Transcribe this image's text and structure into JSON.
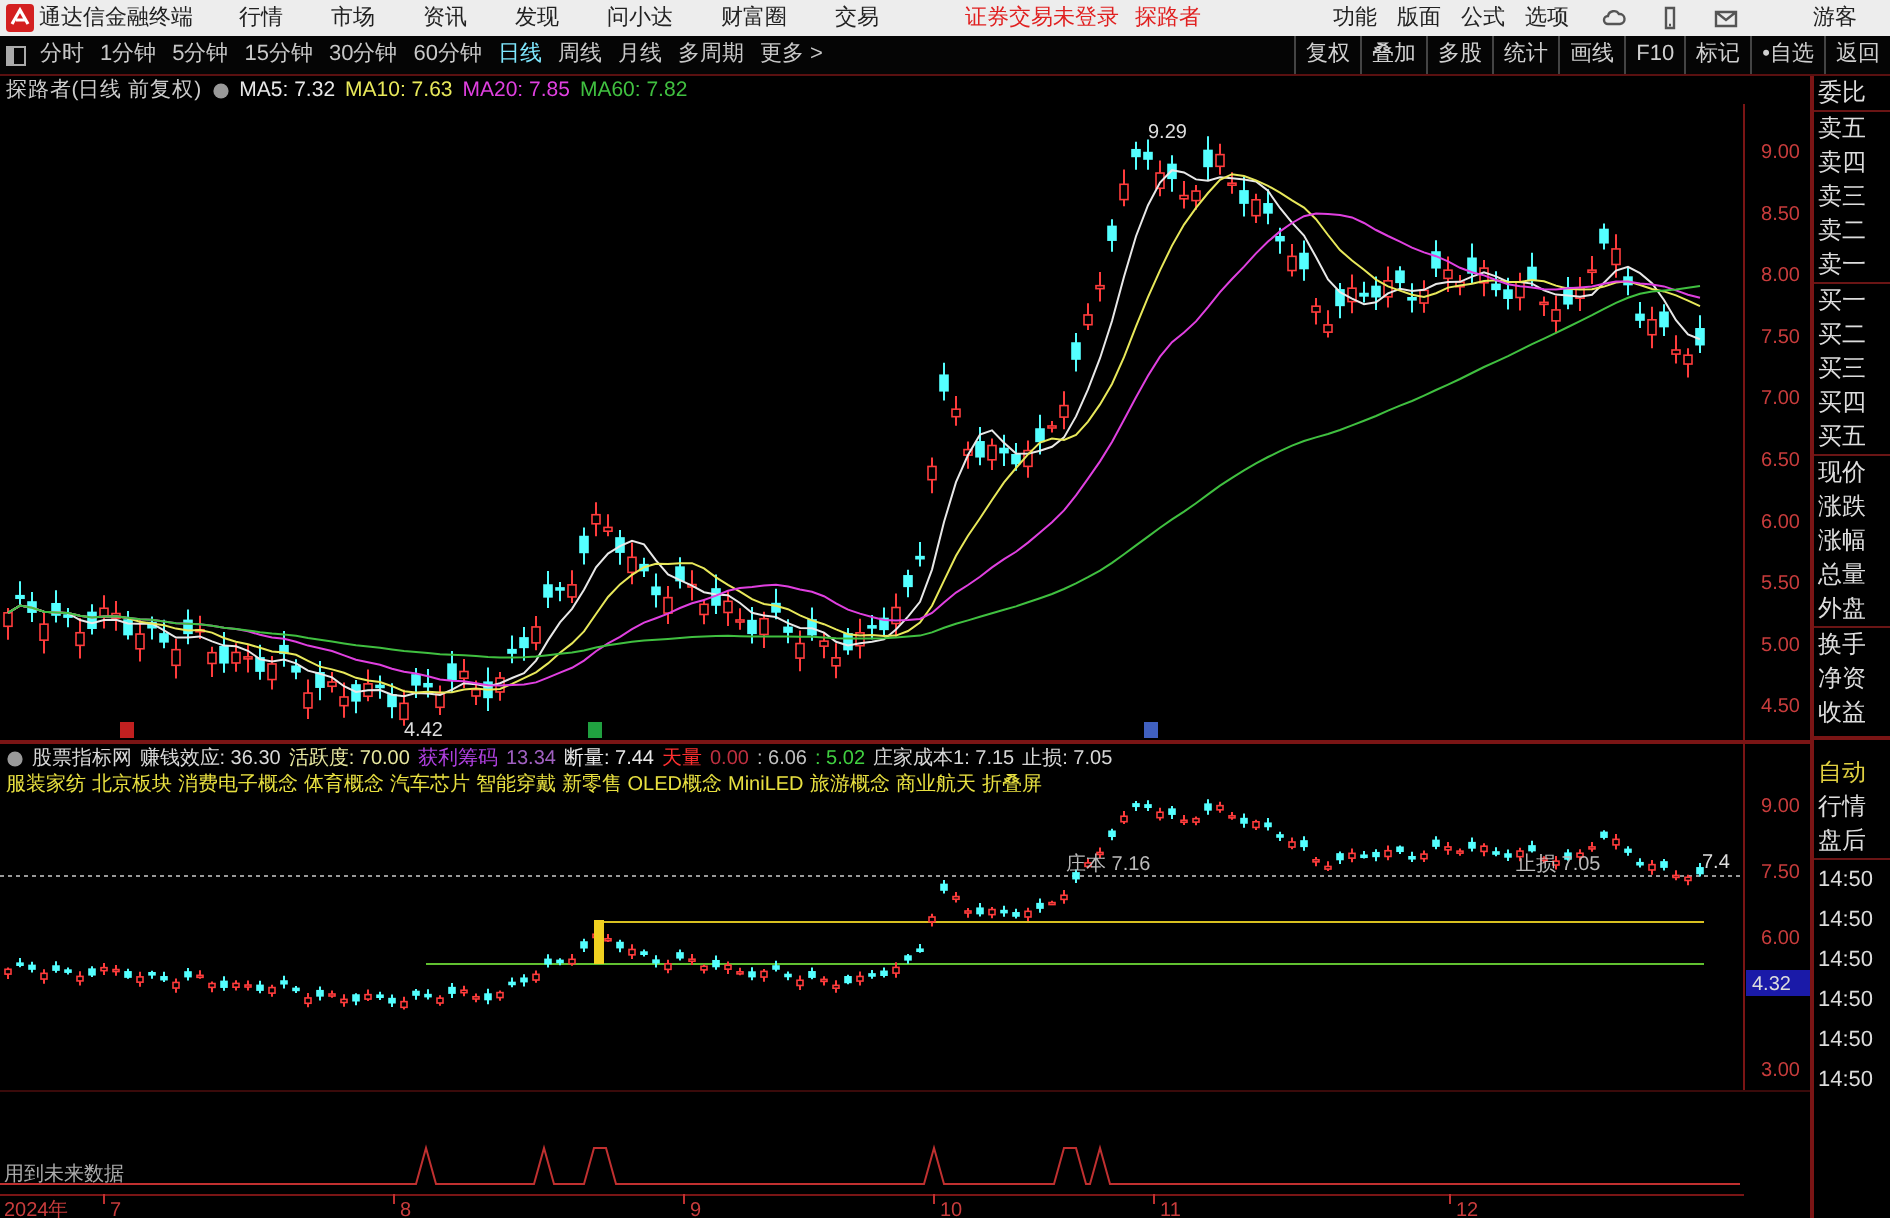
{
  "app_bar": {
    "title": "通达信金融终端",
    "menus": [
      "行情",
      "市场",
      "资讯",
      "发现",
      "问小达",
      "财富圈",
      "交易"
    ],
    "login_status": "证券交易未登录",
    "stock_name": "探路者",
    "tools": [
      "功能",
      "版面",
      "公式",
      "选项"
    ],
    "user": "游客"
  },
  "period_bar": {
    "periods": [
      {
        "label": "分时",
        "selected": false
      },
      {
        "label": "1分钟",
        "selected": false
      },
      {
        "label": "5分钟",
        "selected": false
      },
      {
        "label": "15分钟",
        "selected": false
      },
      {
        "label": "30分钟",
        "selected": false
      },
      {
        "label": "60分钟",
        "selected": false
      },
      {
        "label": "日线",
        "selected": true
      },
      {
        "label": "周线",
        "selected": false
      },
      {
        "label": "月线",
        "selected": false
      },
      {
        "label": "多周期",
        "selected": false
      }
    ],
    "more": "更多 >",
    "actions": [
      "复权",
      "叠加",
      "多股",
      "统计",
      "画线",
      "F10",
      "标记",
      "•自选",
      "返回"
    ]
  },
  "main_chart": {
    "title": "探路者(日线 前复权)",
    "ma": [
      {
        "label": "MA5: 7.32",
        "color": "#e8e8e8"
      },
      {
        "label": "MA10: 7.63",
        "color": "#e8e85a"
      },
      {
        "label": "MA20: 7.85",
        "color": "#e040e0"
      },
      {
        "label": "MA60: 7.82",
        "color": "#40c040"
      }
    ],
    "price_ticks": [
      "9.00",
      "8.50",
      "8.00",
      "7.50",
      "7.00",
      "6.50",
      "6.00",
      "5.50",
      "5.00",
      "4.50"
    ],
    "high_label": "9.29",
    "low_label": "4.42"
  },
  "quote_panel": [
    "委比",
    "卖五",
    "卖四",
    "卖三",
    "卖二",
    "卖一",
    "买一",
    "买二",
    "买三",
    "买四",
    "买五",
    "现价",
    "涨跌",
    "涨幅",
    "总量",
    "外盘",
    "换手",
    "净资",
    "收益"
  ],
  "indicator": {
    "name": "股票指标网",
    "items": [
      {
        "text": "赚钱效应: 36.30",
        "color": "#d8d8d8"
      },
      {
        "text": "活跃度: 70.00",
        "color": "#e8e8a0"
      },
      {
        "text": "获利筹码",
        "color": "#b040e0"
      },
      {
        "text": "13.34",
        "color": "#a060c0"
      },
      {
        "text": "断量: 7.44",
        "color": "#e8e8e8"
      },
      {
        "text": "天量",
        "color": "#ff3030"
      },
      {
        "text": "0.00",
        "color": "#c03040"
      },
      {
        "text": ": 6.06",
        "color": "#c0c0c0"
      },
      {
        "text": ": 5.02",
        "color": "#40d040"
      },
      {
        "text": "庄家成本1: 7.15",
        "color": "#d8d8d8"
      },
      {
        "text": "止损: 7.05",
        "color": "#d8d8d8"
      }
    ],
    "sectors": [
      "服装家纺",
      "北京板块",
      "消费电子概念",
      "体育概念",
      "汽车芯片",
      "智能穿戴",
      "新零售",
      "OLED概念",
      "MiniLED",
      "旅游概念",
      "商业航天",
      "折叠屏"
    ]
  },
  "sub_chart": {
    "ticks": [
      "9.00",
      "7.50",
      "6.00",
      "3.00"
    ],
    "current": "4.32",
    "cost_label": "庄本 7.16",
    "stop_label": "止损 7.05",
    "last_label": "7.4"
  },
  "side_panel": {
    "items": [
      "自动",
      "行情",
      "盘后"
    ],
    "times": [
      "14:50",
      "14:50",
      "14:50",
      "14:50",
      "14:50",
      "14:50"
    ]
  },
  "signal_pane": {
    "note": "用到未来数据"
  },
  "date_axis": [
    "2024年",
    "7",
    "8",
    "9",
    "10",
    "11",
    "12"
  ]
}
